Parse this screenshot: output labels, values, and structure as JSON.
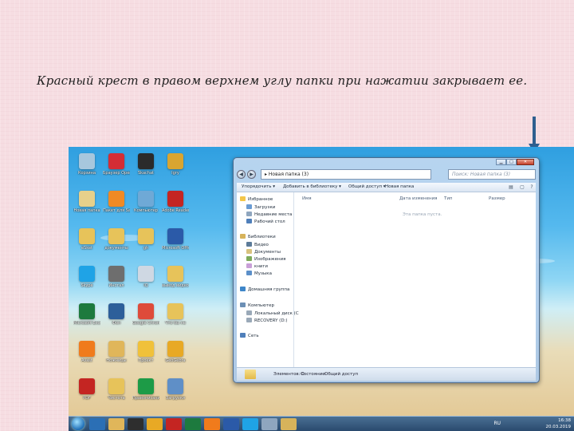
{
  "caption": "Красный крест в правом верхнем углу папки при нажатии закрывает ее.",
  "desktop_icons": [
    {
      "label": "Корзина",
      "color": "#a7c7dd"
    },
    {
      "label": "Браузер Opera",
      "color": "#d42d35"
    },
    {
      "label": "Skachat",
      "color": "#2b2b2b"
    },
    {
      "label": "Igry",
      "color": "#d9a531"
    },
    {
      "label": "Новая папка",
      "color": "#e7d08a"
    },
    {
      "label": "Пакет для Sale",
      "color": "#f08a24"
    },
    {
      "label": "Компьютер",
      "color": "#6fa9d6"
    },
    {
      "label": "Adobe Reader X",
      "color": "#c42522"
    },
    {
      "label": "eSket",
      "color": "#e7c35a"
    },
    {
      "label": "документы",
      "color": "#e7c35a"
    },
    {
      "label": "gh",
      "color": "#e7c35a"
    },
    {
      "label": "Microsoft Office Word",
      "color": "#2b5aa8"
    },
    {
      "label": "Skype",
      "color": "#1fa3e6"
    },
    {
      "label": "Инстал",
      "color": "#6e6e6e"
    },
    {
      "label": "IQ",
      "color": "#cfd8e3"
    },
    {
      "label": "вывод видео",
      "color": "#e7c35a"
    },
    {
      "label": "Microsoft Excel 2010",
      "color": "#1d7a3e"
    },
    {
      "label": "Фон",
      "color": "#2d5f9a"
    },
    {
      "label": "Google Chrome",
      "color": "#de4b3a"
    },
    {
      "label": "Что бы не",
      "color": "#e7c35a"
    },
    {
      "label": "Avast",
      "color": "#f07b1c"
    },
    {
      "label": "Ножницы",
      "color": "#e0b65a"
    },
    {
      "label": "Проект",
      "color": "#f0c13a"
    },
    {
      "label": "GeoGebra",
      "color": "#e8a925"
    },
    {
      "label": "PDF",
      "color": "#c42522"
    },
    {
      "label": "Чистота",
      "color": "#e7c35a"
    },
    {
      "label": "Правописание",
      "color": "#1d9b47"
    },
    {
      "label": "Загрузки",
      "color": "#5f8fc7"
    }
  ],
  "window": {
    "minimize": "▁",
    "maximize": "□",
    "close": "✕",
    "back": "◀",
    "forward": "▶",
    "path": "▸ Новая папка (3)",
    "search_placeholder": "Поиск: Новая папка (3)",
    "toolbar": {
      "organize": "Упорядочить ▾",
      "add_library": "Добавить в библиотеку ▾",
      "share": "Общий доступ ▾",
      "new_folder": "Новая папка"
    },
    "nav": {
      "favorites": "Избранное",
      "downloads": "Загрузки",
      "recent": "Недавние места",
      "desktop": "Рабочий стол",
      "libraries": "Библиотеки",
      "video": "Видео",
      "documents": "Документы",
      "images": "Изображения",
      "books": "книги",
      "music": "Музыка",
      "homegroup": "Домашняя группа",
      "computer": "Компьютер",
      "local_disk": "Локальный диск (C",
      "recovery": "RECOVERY (D:)",
      "network": "Сеть"
    },
    "columns": {
      "name": "Имя",
      "modified": "Дата изменения",
      "type": "Тип",
      "size": "Размер"
    },
    "empty_text": "Эта папка пуста.",
    "status": {
      "elements": "Элементов: 0",
      "state_label": "Состояние:",
      "state_value": "Общий доступ"
    }
  },
  "taskbar": {
    "lang": "RU",
    "time": "16:38",
    "date": "20.03.2019"
  },
  "colors": {
    "arrow": "#2f5f8f",
    "close_button": "#c6402a"
  }
}
